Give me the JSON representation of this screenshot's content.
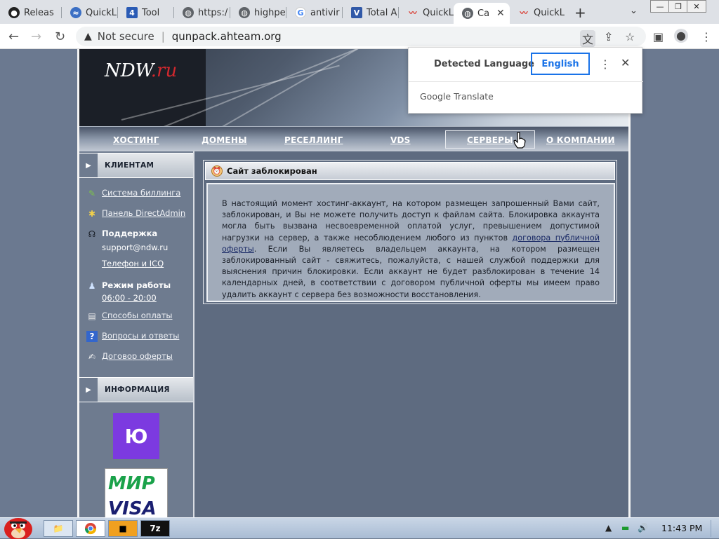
{
  "browser": {
    "tabs": [
      {
        "label": "Releas",
        "icon": "github-icon"
      },
      {
        "label": "QuickL",
        "icon": "quick-icon"
      },
      {
        "label": "Tool",
        "icon": "tool-icon"
      },
      {
        "label": "https:/",
        "icon": "globe-icon"
      },
      {
        "label": "highpe",
        "icon": "globe-icon"
      },
      {
        "label": "antivir",
        "icon": "google-icon"
      },
      {
        "label": "Total A",
        "icon": "total-icon"
      },
      {
        "label": "QuickL",
        "icon": "pulse-icon"
      },
      {
        "label": "Ca",
        "icon": "globe-icon",
        "active": true
      },
      {
        "label": "QuickL",
        "icon": "pulse-icon"
      }
    ],
    "new_tab": "+",
    "security_label": "Not secure",
    "url": "qunpack.ahteam.org"
  },
  "translate_popup": {
    "source_language": "Detected Language",
    "target_language": "English",
    "brand": "Google",
    "product": "Translate"
  },
  "site": {
    "logo_main": "NDW",
    "logo_suffix": ".ru",
    "menu": [
      {
        "label": "ХОСТИНГ"
      },
      {
        "label": "ДОМЕНЫ"
      },
      {
        "label": "РЕСЕЛЛИНГ"
      },
      {
        "label": "VDS"
      },
      {
        "label": "СЕРВЕРЫ",
        "active": true
      },
      {
        "label": "О КОМПАНИИ"
      }
    ],
    "sidebar": {
      "clients_title": "КЛИЕНТАМ",
      "billing": "Система биллинга",
      "panel": "Панель DirectAdmin",
      "support_title": "Поддержка",
      "support_email": "support@ndw.ru",
      "phone_icq": "Телефон и ICQ",
      "hours_title": "Режим работы",
      "hours": "06:00 - 20:00",
      "payment": "Способы оплаты",
      "faq": "Вопросы и ответы",
      "offer": "Договор оферты",
      "info_title": "ИНФОРМАЦИЯ",
      "badge_yoo": "Ю",
      "badge_mir": "МИР",
      "badge_visa": "VISA"
    },
    "content": {
      "title": "Сайт заблокирован",
      "text_part1": "В настоящий момент хостинг-аккаунт, на котором размещен запрошенный Вами сайт, заблокирован, и Вы не можете получить доступ к файлам сайта. Блокировка аккаунта могла быть вызвана несвоевременной оплатой услуг, превышением допустимой нагрузки на сервер, а также несоблюдением любого из пунктов ",
      "text_link": "договора публичной оферты",
      "text_part2": ". Если Вы являетесь владельцем аккаунта, на котором размещен заблокированный сайт - свяжитесь, пожалуйста, с нашей службой поддержки для выяснения причин блокировки. Если аккаунт не будет разблокирован в течение 14 календарных дней, в соответствии с договором публичной оферты мы имеем право удалить аккаунт с сервера без возможности восстановления."
    }
  },
  "taskbar": {
    "clock": "11:43 PM",
    "app4_label": "7z"
  }
}
